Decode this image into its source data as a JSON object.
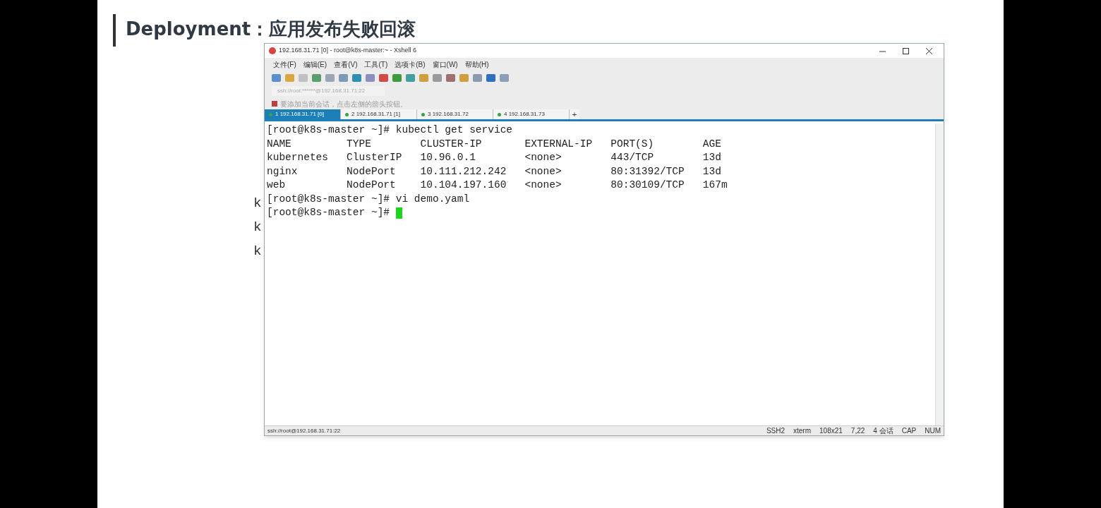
{
  "slide": {
    "title": "Deployment：应用发布失败回滚",
    "fragments": [
      "k",
      "k",
      "k"
    ]
  },
  "window": {
    "title": "192.168.31.71 [0] - root@k8s-master:~ - Xshell 6"
  },
  "menu": [
    "文件(F)",
    "编辑(E)",
    "查看(V)",
    "工具(T)",
    "选项卡(B)",
    "窗口(W)",
    "帮助(H)"
  ],
  "address_bar": {
    "value": "ssh://root:******@192.168.31.71:22"
  },
  "info_bar": {
    "text": "要添加当前会话，点击左侧的箭头按钮。"
  },
  "tabs": [
    {
      "label": "1 192.168.31.71 [0]",
      "selected": true
    },
    {
      "label": "2 192.168.31.71 [1]",
      "selected": false
    },
    {
      "label": "3 192.168.31.72",
      "selected": false
    },
    {
      "label": "4 192.168.31.73",
      "selected": false
    }
  ],
  "new_tab": "+",
  "terminal": {
    "lines": [
      "[root@k8s-master ~]# kubectl get service",
      "NAME         TYPE        CLUSTER-IP       EXTERNAL-IP   PORT(S)        AGE",
      "kubernetes   ClusterIP   10.96.0.1        <none>        443/TCP        13d",
      "nginx        NodePort    10.111.212.242   <none>        80:31392/TCP   13d",
      "web          NodePort    10.104.197.160   <none>        80:30109/TCP   167m",
      "[root@k8s-master ~]# vi demo.yaml",
      "[root@k8s-master ~]# "
    ],
    "cursor": true
  },
  "status_bar": {
    "left": "ssh://root@192.168.31.71:22",
    "items": [
      "SSH2",
      "xterm",
      "108x21",
      "7,22",
      "4 会话",
      "CAP",
      "NUM"
    ]
  }
}
